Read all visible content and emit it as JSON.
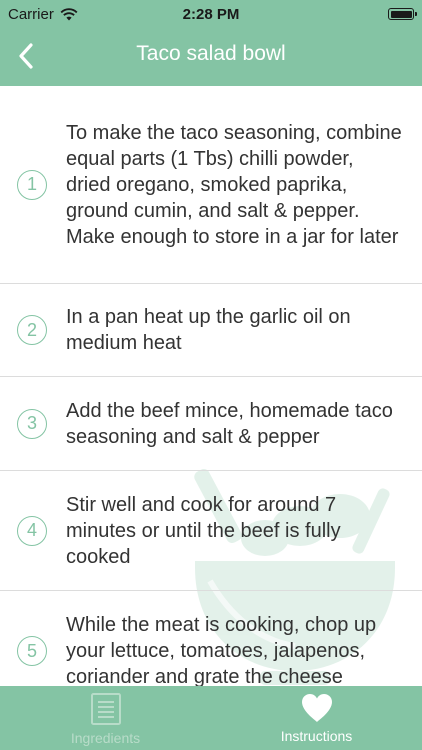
{
  "status_bar": {
    "carrier": "Carrier",
    "time": "2:28 PM",
    "wifi_icon": "wifi-icon",
    "battery_icon": "battery-icon",
    "battery_level": 1.0
  },
  "nav": {
    "title": "Taco salad bowl",
    "back_icon": "chevron-left-icon"
  },
  "steps": [
    {
      "number": "1",
      "text": "To make the taco seasoning, combine equal parts (1 Tbs) chilli powder, dried oregano, smoked paprika, ground cumin, and salt & pepper. Make enough to store in a jar for later"
    },
    {
      "number": "2",
      "text": "In a pan heat up the garlic oil on medium heat"
    },
    {
      "number": "3",
      "text": "Add the beef mince, homemade taco seasoning and salt & pepper"
    },
    {
      "number": "4",
      "text": "Stir well and cook for around 7 minutes or until the beef is fully cooked"
    },
    {
      "number": "5",
      "text": "While the meat is cooking, chop up your lettuce, tomatoes, jalapenos, coriander and grate the cheese"
    }
  ],
  "tabs": [
    {
      "label": "Ingredients",
      "icon": "document-list-icon",
      "active": false
    },
    {
      "label": "Instructions",
      "icon": "heart-icon",
      "active": true
    }
  ],
  "colors": {
    "accent": "#84c4a4",
    "text": "#333333",
    "inactive_tab": "#b8dcc9",
    "divider": "#dcdcdc"
  }
}
